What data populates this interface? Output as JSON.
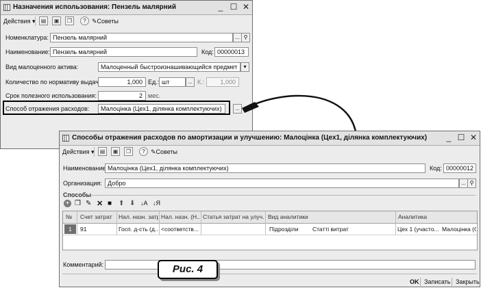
{
  "window1": {
    "title": "Назначения использования: Пензель малярний",
    "toolbar": {
      "actions_label": "Действия",
      "tips_label": "Советы"
    },
    "fields": {
      "nomenclature_label": "Номенклатура:",
      "nomenclature_value": "Пензель малярний",
      "name_label": "Наименование:",
      "name_value": "Пензель малярний",
      "code_label": "Код:",
      "code_value": "00000013",
      "asset_type_label": "Вид малоценного актива:",
      "asset_type_value": "Малоценный быстроизнашивающийся предмет",
      "qty_label": "Количество по нормативу выдачи:",
      "qty_value": "1,000",
      "unit_label": "Ед.:",
      "unit_value": "шт",
      "k_label": "К.:",
      "k_value": "1,000",
      "term_label": "Срок полезного использования:",
      "term_value": "2",
      "term_unit": "мес.",
      "expense_method_label": "Способ отражения расходов:",
      "expense_method_value": "Малоцінка (Цех1, ділянка комплектуючих)"
    }
  },
  "window2": {
    "title": "Способы отражения расходов по амортизации и улучшению: Малоцінка (Цех1, ділянка комплектуючих)",
    "toolbar": {
      "actions_label": "Действия",
      "tips_label": "Советы"
    },
    "fields": {
      "name_label": "Наименование:",
      "name_value": "Малоцінка (Цех1, ділянка комплектуючих)",
      "code_label": "Код:",
      "code_value": "00000012",
      "org_label": "Организация:",
      "org_value": "Добро"
    },
    "methods_label": "Способы",
    "grid": {
      "columns": [
        "№",
        "Счет затрат",
        "Нал. назн. затр.",
        "Нал. назн. (Н...",
        "Статья затрат на улуч...",
        "Вид аналитики",
        "Аналитика"
      ],
      "rows": [
        {
          "num": "1",
          "account": "91",
          "tax_purpose": "Госп. д-сть (д...",
          "tax_purpose_n": "<соответств...",
          "cost_item": "",
          "analytics_type_1": "Підрозділи",
          "analytics_type_2": "Статті витрат",
          "analytics_1": "Цех 1 (участо...",
          "analytics_2": "Малоцінка (О..."
        }
      ]
    },
    "comment_label": "Комментарий:",
    "comment_value": "",
    "footer": {
      "ok": "OK",
      "save": "Записать",
      "close": "Закрыть"
    }
  },
  "figure_caption": "Рис. 4"
}
